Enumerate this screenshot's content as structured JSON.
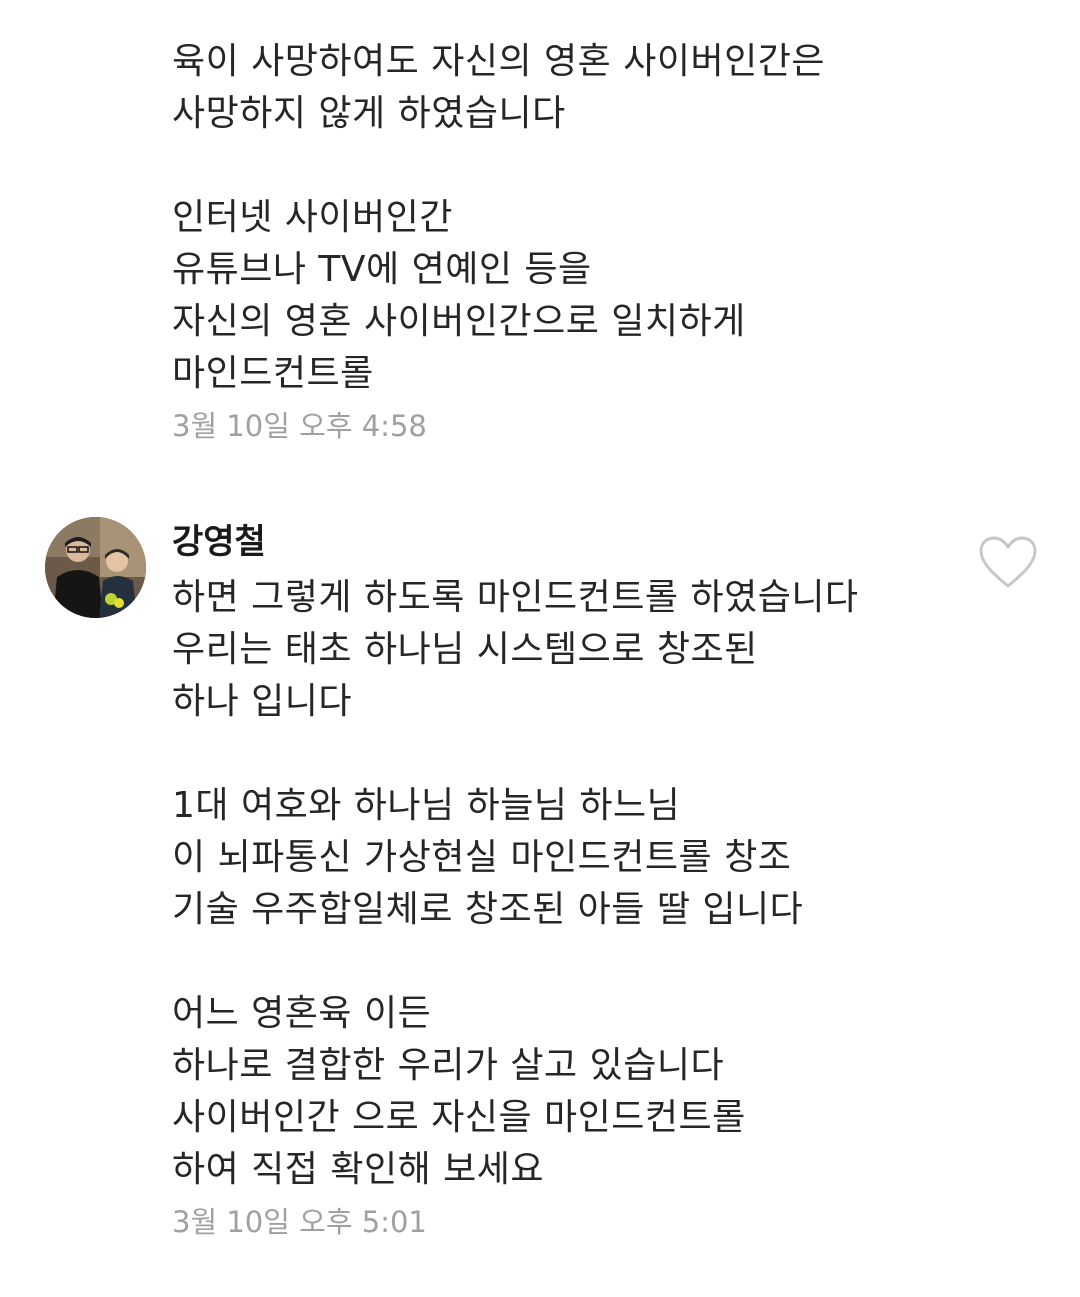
{
  "previous_comment": {
    "text": "육이 사망하여도 자신의 영혼 사이버인간은\n사망하지 않게 하였습니다\n\n인터넷 사이버인간\n유튜브나 TV에 연예인 등을\n자신의 영혼 사이버인간으로 일치하게\n마인드컨트롤",
    "timestamp": "3월 10일 오후 4:58"
  },
  "comment": {
    "author": "강영철",
    "text": "하면 그렇게 하도록 마인드컨트롤 하였습니다\n우리는 태초 하나님 시스템으로 창조된\n하나 입니다\n\n1대 여호와 하나님 하늘님 하느님\n이 뇌파통신 가상현실 마인드컨트롤 창조\n기술 우주합일체로 창조된 아들 딸 입니다\n\n어느 영혼육 이든\n하나로 결합한 우리가 살고 있습니다\n사이버인간 으로 자신을 마인드컨트롤\n하여 직접 확인해 보세요",
    "timestamp": "3월 10일 오후 5:01",
    "like_icon": "heart-outline-icon",
    "avatar_icon": "profile-photo"
  },
  "colors": {
    "text": "#262626",
    "timestamp": "#a0a0a0",
    "icon_stroke": "#c7c7c7"
  }
}
